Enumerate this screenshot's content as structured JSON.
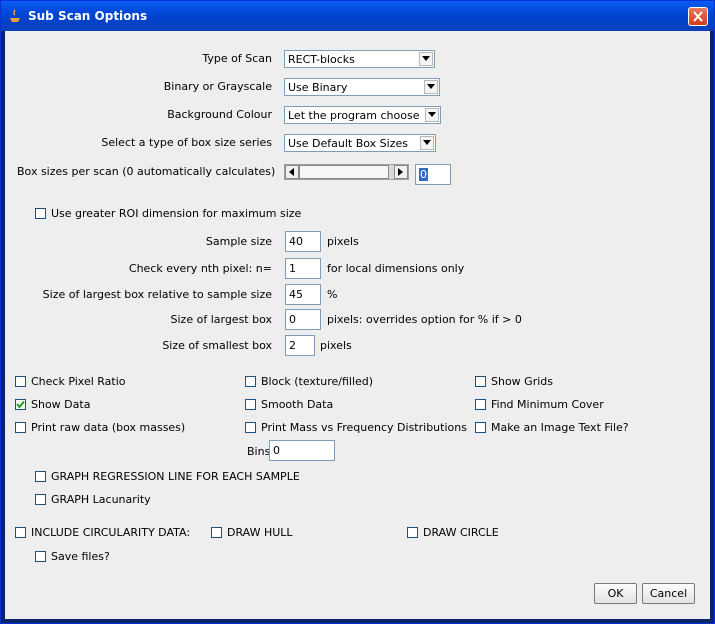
{
  "window": {
    "title": "Sub Scan Options"
  },
  "scan_type": {
    "label": "Type of Scan",
    "value": "RECT-blocks"
  },
  "binary_grayscale": {
    "label": "Binary or Grayscale",
    "value": "Use Binary"
  },
  "background": {
    "label": "Background Colour",
    "value": "Let the program choose"
  },
  "box_series": {
    "label": "Select a type of box size series",
    "value": "Use Default Box Sizes"
  },
  "box_sizes": {
    "label": "Box sizes per scan (0 automatically calculates)",
    "value": "0"
  },
  "greater_roi": {
    "label": "Use greater ROI dimension for maximum size",
    "checked": false
  },
  "sample_size": {
    "label": "Sample size",
    "value": "40",
    "unit": "pixels"
  },
  "nth_pixel": {
    "label": "Check every nth pixel: n=",
    "value": "1",
    "unit": "for local dimensions only"
  },
  "largest_relative": {
    "label": "Size of largest box relative to sample size",
    "value": "45",
    "unit": "%"
  },
  "largest_box": {
    "label": "Size of largest box",
    "value": "0",
    "unit": "pixels: overrides option for % if > 0"
  },
  "smallest_box": {
    "label": "Size of smallest box",
    "value": "2",
    "unit": "pixels"
  },
  "checkboxes": {
    "pixel_ratio": {
      "label": "Check Pixel Ratio",
      "checked": false
    },
    "block": {
      "label": "Block (texture/filled)",
      "checked": false
    },
    "show_grids": {
      "label": "Show Grids",
      "checked": false
    },
    "show_data": {
      "label": "Show Data",
      "checked": true
    },
    "smooth_data": {
      "label": "Smooth Data",
      "checked": false
    },
    "find_min_cover": {
      "label": "Find Minimum Cover",
      "checked": false
    },
    "print_raw": {
      "label": "Print raw data (box masses)",
      "checked": false
    },
    "print_mass": {
      "label": "Print Mass vs Frequency Distributions",
      "checked": false
    },
    "image_text": {
      "label": "Make an Image Text File?",
      "checked": false
    },
    "graph_regression": {
      "label": "GRAPH REGRESSION LINE FOR EACH SAMPLE",
      "checked": false
    },
    "graph_lacunarity": {
      "label": "GRAPH Lacunarity",
      "checked": false
    },
    "circularity": {
      "label": "INCLUDE CIRCULARITY DATA:",
      "checked": false
    },
    "draw_hull": {
      "label": "DRAW HULL",
      "checked": false
    },
    "draw_circle": {
      "label": "DRAW CIRCLE",
      "checked": false
    },
    "save_files": {
      "label": "Save files?",
      "checked": false
    }
  },
  "bins": {
    "label": "Bins",
    "value": "0"
  },
  "buttons": {
    "ok": "OK",
    "cancel": "Cancel"
  }
}
